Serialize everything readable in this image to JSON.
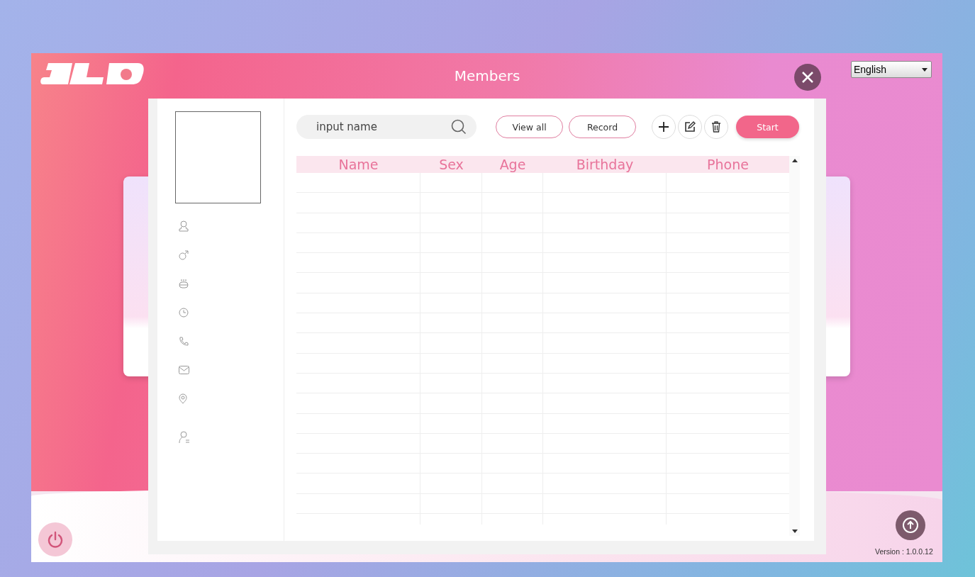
{
  "window": {
    "language": "English",
    "version": "Version : 1.0.0.12"
  },
  "dialog": {
    "title": "Members",
    "search": {
      "placeholder": "input name"
    },
    "buttons": [
      {
        "kind": "outline",
        "label": "View all"
      },
      {
        "kind": "outline",
        "label": "Record"
      },
      {
        "kind": "add"
      },
      {
        "kind": "edit"
      },
      {
        "kind": "delete"
      },
      {
        "kind": "primary",
        "label": "Start"
      }
    ],
    "detail_fields": [
      {
        "kind": "person"
      },
      {
        "kind": "sex"
      },
      {
        "kind": "birthday"
      },
      {
        "kind": "age"
      },
      {
        "kind": "phone"
      },
      {
        "kind": "email"
      },
      {
        "kind": "address"
      },
      {
        "kind": "note"
      }
    ],
    "table": {
      "columns": [
        "Name",
        "Sex",
        "Age",
        "Birthday",
        "Phone"
      ]
    }
  }
}
